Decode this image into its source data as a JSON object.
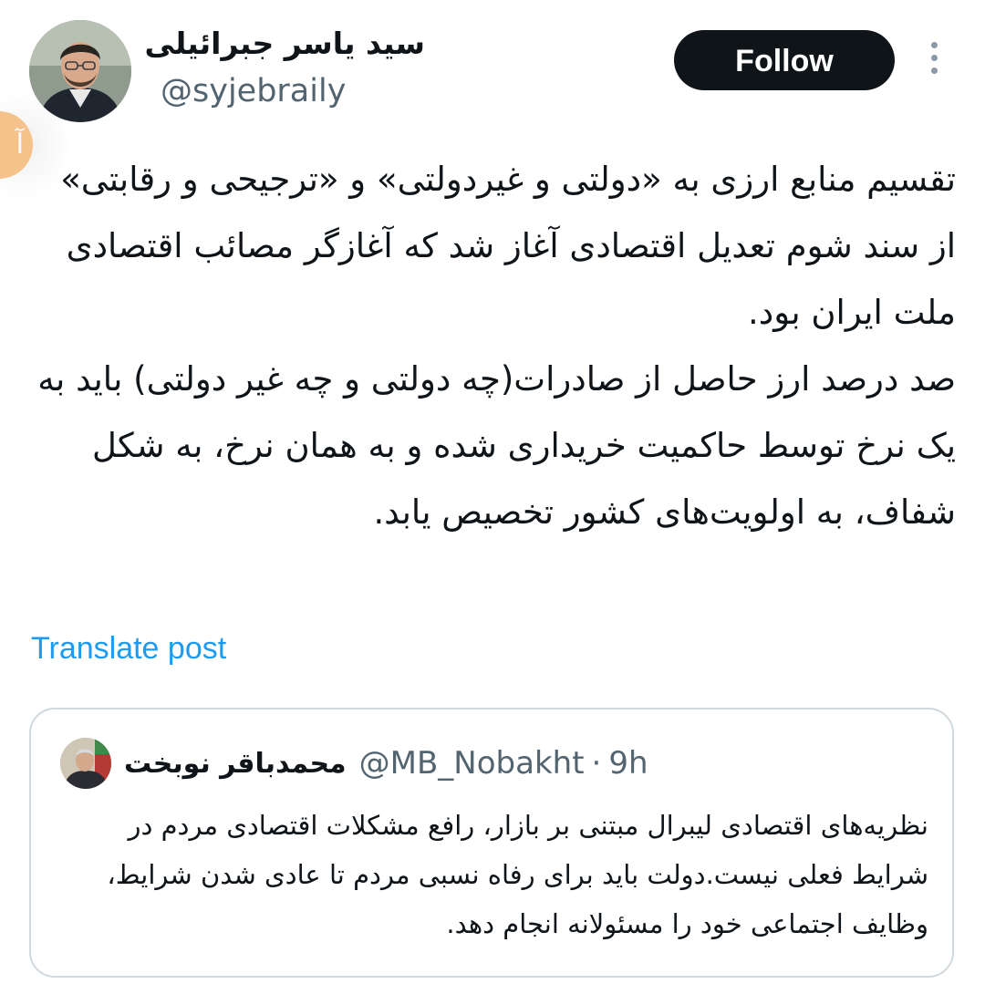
{
  "author": {
    "name": "سید یاسر جبرائیلی",
    "handle": "@syjebraily"
  },
  "actions": {
    "follow_label": "Follow",
    "more_icon": "more-vertical-icon"
  },
  "post": {
    "paragraphs": [
      "تقسیم منابع ارزی به «دولتی و غیردولتی» و «ترجیحی و رقابتی» از سند شوم تعدیل اقتصادی آغاز شد که آغازگر مصائب اقتصادی ملت ایران بود.",
      "صد درصد ارز حاصل از صادرات(چه دولتی و چه غیر دولتی) باید به یک نرخ توسط حاکمیت خریداری شده و به همان نرخ، به شکل شفاف، به اولویت‌های کشور تخصیص یابد."
    ],
    "translate_label": "Translate post"
  },
  "quote": {
    "name": "محمدباقر نوبخت",
    "handle": "@MB_Nobakht",
    "separator": "·",
    "time": "9h",
    "text": "نظریه‌های اقتصادی لیبرال مبتنی بر بازار، رافع مشکلات اقتصادی مردم در شرایط فعلی نیست.دولت باید برای رفاه نسبی مردم تا عادی شدن شرایط، وظایف اجتماعی خود را مسئولانه انجام دهد."
  },
  "colors": {
    "text_primary": "#0f1419",
    "text_secondary": "#536471",
    "link": "#1d9bf0",
    "follow_bg": "#0f1419",
    "border": "#cfd9de"
  }
}
